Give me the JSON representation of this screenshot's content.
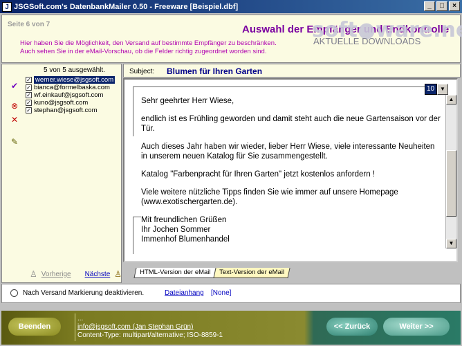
{
  "window": {
    "title": "JSGSoft.com's DatenbankMailer 0.50 - Freeware   [Beispiel.dbf]",
    "icon_letter": "J"
  },
  "header": {
    "step": "Seite 6 von 7",
    "heading": "Auswahl der Empfänger und Endkontrolle",
    "info_line1": "Hier haben Sie die Möglichkeit, den Versand auf bestimmte Empfänger zu beschränken.",
    "info_line2": "Auch sehen Sie in der eMail-Vorschau, ob die Felder richtig zugeordnet worden sind."
  },
  "watermark": {
    "main": "soft●ware.net",
    "sub": "AKTUELLE DOWNLOADS"
  },
  "recipients": {
    "count_label": "5 von 5 ausgewählt.",
    "items": [
      {
        "email": "werner.wiese@jsgsoft.com",
        "checked": true,
        "selected": true
      },
      {
        "email": "bianca@formelbaska.com",
        "checked": true,
        "selected": false
      },
      {
        "email": "wf.einkauf@jsgsoft.com",
        "checked": true,
        "selected": false
      },
      {
        "email": "kuno@jsgsoft.com",
        "checked": true,
        "selected": false
      },
      {
        "email": "stephan@jsgsoft.com",
        "checked": true,
        "selected": false
      }
    ],
    "prev_label": "Vorherige",
    "next_label": "Nächste"
  },
  "subject": {
    "label": "Subject:",
    "value": "Blumen für Ihren Garten"
  },
  "mail": {
    "zoom": "10",
    "greeting": "Sehr geehrter Herr Wiese,",
    "para1": "endlich ist es Frühling geworden und damit steht auch die neue Gartensaison vor der Tür.",
    "para2": "Auch dieses Jahr haben wir wieder, lieber Herr Wiese, viele interessante Neuheiten in unserem neuen Katalog für Sie zusammengestellt.",
    "para3": "Katalog \"Farbenpracht für Ihren Garten\" jetzt kostenlos anfordern !",
    "para4": "Viele weitere nützliche Tipps finden Sie wie immer auf unsere Homepage (www.exotischergarten.de).",
    "closing1": "Mit freundlichen Grüßen",
    "closing2": "Ihr Jochen Sommer",
    "closing3": "Immenhof Blumenhandel"
  },
  "tabs": {
    "html": "HTML-Version der eMail",
    "text": "Text-Version der eMail",
    "active": "text"
  },
  "options": {
    "deactivate_label": "Nach Versand Markierung deaktivieren.",
    "attachment_label": "Dateianhang",
    "attachment_value": "[None]"
  },
  "footer": {
    "end_label": "Beenden",
    "dots": "...",
    "sender": "info@jsgsoft.com (Jan Stephan Grün)",
    "content_type": "Content-Type: multipart/alternative; ISO-8859-1",
    "back_label": "<< Zurück",
    "next_label": "Weiter >>"
  }
}
